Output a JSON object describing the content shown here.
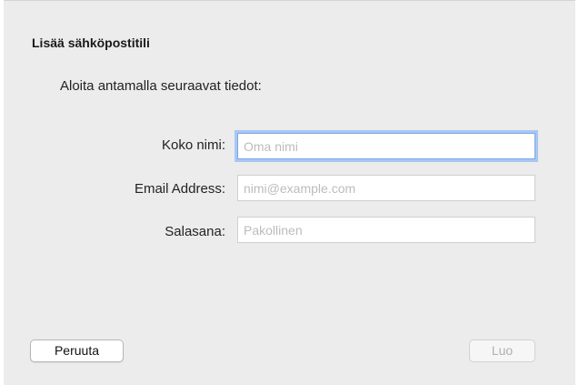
{
  "dialog": {
    "title": "Lisää sähköpostitili",
    "subtitle": "Aloita antamalla seuraavat tiedot:"
  },
  "form": {
    "fields": [
      {
        "label": "Koko nimi:",
        "value": "",
        "placeholder": "Oma nimi",
        "focused": true
      },
      {
        "label": "Email Address:",
        "value": "",
        "placeholder": "nimi@example.com",
        "focused": false
      },
      {
        "label": "Salasana:",
        "value": "",
        "placeholder": "Pakollinen",
        "focused": false
      }
    ]
  },
  "buttons": {
    "cancel_label": "Peruuta",
    "create_label": "Luo",
    "create_enabled": false
  },
  "colors": {
    "background": "#ececec",
    "focus_ring": "#a9c7f2",
    "placeholder": "#bcbcbc",
    "disabled_text": "#b0b0b0"
  }
}
